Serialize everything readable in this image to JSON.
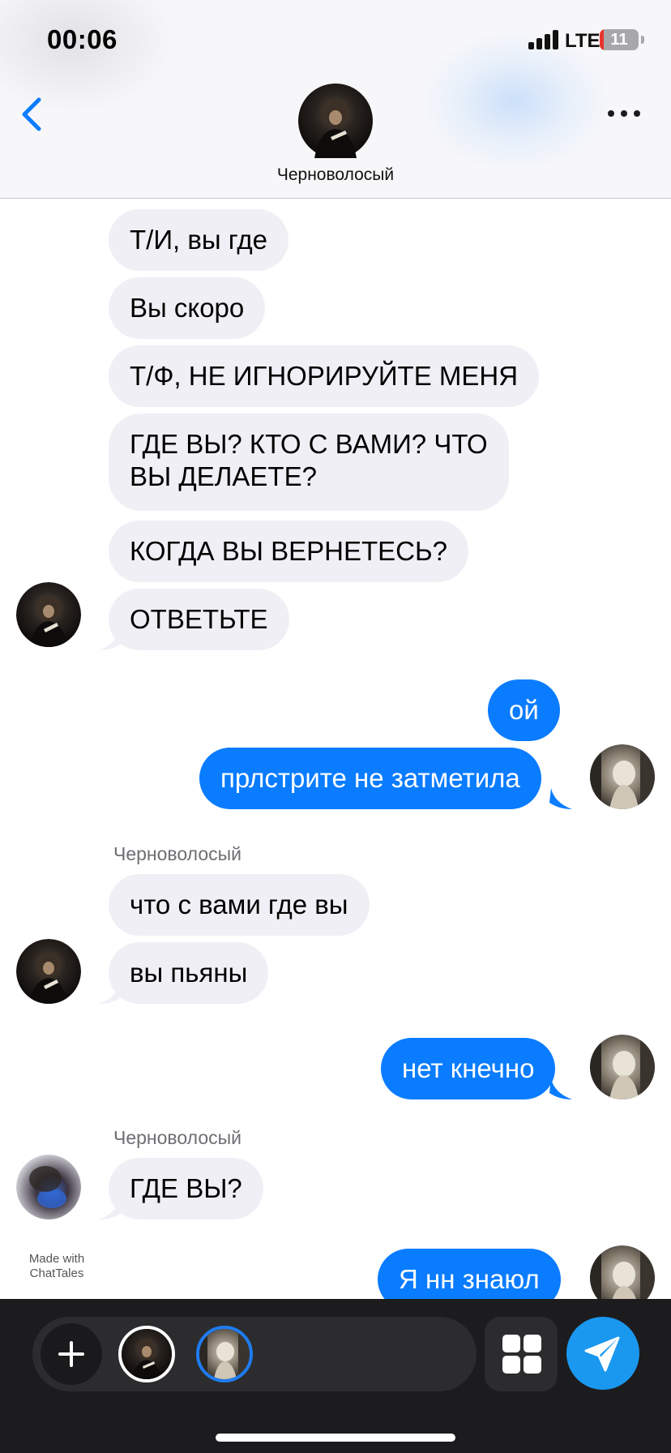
{
  "status_bar": {
    "time": "00:06",
    "network": "LTE",
    "battery": "11",
    "battery_level": 0.11
  },
  "header": {
    "contact_name": "Черноволосый",
    "back_icon": "chevron-left-icon",
    "more_icon": "more-horizontal-icon"
  },
  "messages": [
    {
      "dir": "in",
      "text": "Т/И, вы где"
    },
    {
      "dir": "in",
      "text": "Вы скоро"
    },
    {
      "dir": "in",
      "text": "Т/Ф, НЕ ИГНОРИРУЙТЕ МЕНЯ"
    },
    {
      "dir": "in",
      "text": "ГДЕ ВЫ? КТО С ВАМИ? ЧТО\nВЫ ДЕЛАЕТЕ?"
    },
    {
      "dir": "in",
      "text": "КОГДА ВЫ ВЕРНЕТЕСЬ?"
    },
    {
      "dir": "in",
      "text": "ОТВЕТЬТЕ"
    },
    {
      "dir": "out",
      "text": "ой"
    },
    {
      "dir": "out",
      "text": "прлстрите не затметила"
    },
    {
      "dir": "in",
      "sender": "Черноволосый",
      "text": "что с вами где вы"
    },
    {
      "dir": "in",
      "text": "вы пьяны"
    },
    {
      "dir": "out",
      "text": "нет кнечно"
    },
    {
      "dir": "in",
      "sender": "Черноволосый",
      "text": "ГДЕ ВЫ?"
    },
    {
      "dir": "out",
      "text": "Я нн знаюл"
    }
  ],
  "watermark": {
    "line1": "Made with",
    "line2": "ChatTales"
  },
  "bottom_bar": {
    "plus_icon": "plus-icon",
    "grid_icon": "grid-icon",
    "send_icon": "send-icon"
  },
  "colors": {
    "outgoing": "#0a7cff",
    "incoming": "#f0eff5",
    "accent": "#1a98f0"
  }
}
